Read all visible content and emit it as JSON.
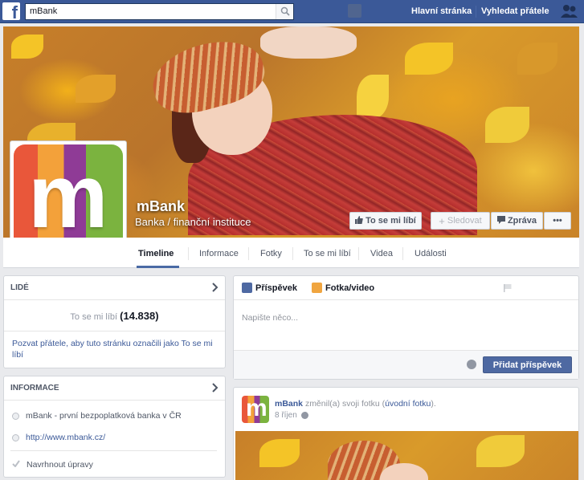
{
  "topbar": {
    "search_value": "mBank",
    "nav_home": "Hlavní stránka",
    "nav_find_friends": "Vyhledat přátele",
    "brand_color": "#3b5998"
  },
  "page": {
    "name": "mBank",
    "category": "Banka / finanční instituce",
    "logo_letter": "m"
  },
  "cover_actions": {
    "like": "To se mi líbí",
    "follow": "Sledovat",
    "message": "Zpráva",
    "more": "•••"
  },
  "tabs": [
    "Timeline",
    "Informace",
    "Fotky",
    "To se mi líbí",
    "Videa",
    "Události"
  ],
  "people": {
    "title": "LIDÉ",
    "likes_label": "To se mi líbí",
    "likes_count": "(14.838)",
    "invite_text": "Pozvat přátele, aby tuto stránku označili jako To se mi líbí"
  },
  "info": {
    "title": "INFORMACE",
    "description": "mBank - první bezpoplatková banka v ČR",
    "url": "http://www.mbank.cz/",
    "suggest_edit": "Navrhnout úpravy"
  },
  "composer": {
    "tab_post": "Příspěvek",
    "tab_photo": "Fotka/video",
    "placeholder": "Napište něco...",
    "submit": "Přidat příspěvek"
  },
  "story": {
    "author": "mBank",
    "action": "změnil(a) svoji fotku (",
    "link": "úvodní fotku",
    "action_end": ").",
    "date": "8 říjen"
  }
}
